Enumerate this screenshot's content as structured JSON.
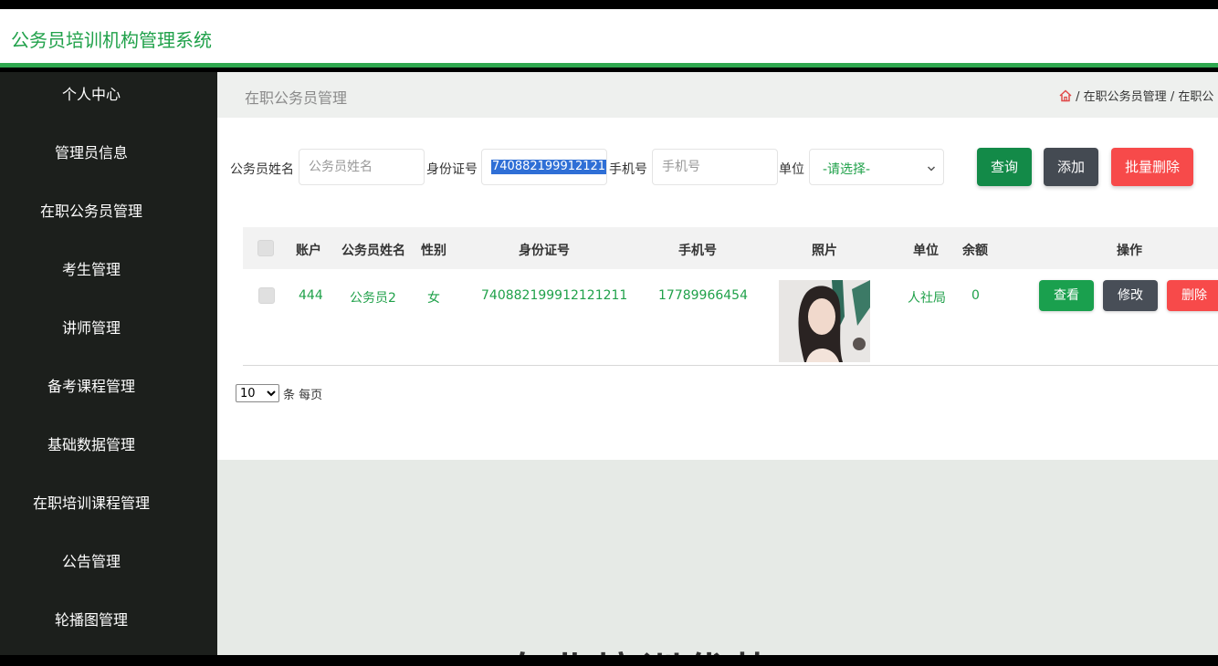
{
  "app": {
    "title": "公务员培训机构管理系统"
  },
  "sidebar": {
    "items": [
      {
        "label": "个人中心"
      },
      {
        "label": "管理员信息"
      },
      {
        "label": "在职公务员管理"
      },
      {
        "label": "考生管理"
      },
      {
        "label": "讲师管理"
      },
      {
        "label": "备考课程管理"
      },
      {
        "label": "基础数据管理"
      },
      {
        "label": "在职培训课程管理"
      },
      {
        "label": "公告管理"
      },
      {
        "label": "轮播图管理"
      }
    ]
  },
  "page": {
    "title": "在职公务员管理",
    "breadcrumb": {
      "sep": "/",
      "item1": "在职公务员管理",
      "item2": "在职公"
    }
  },
  "search": {
    "name_label": "公务员姓名",
    "name_placeholder": "公务员姓名",
    "id_label": "身份证号",
    "id_value": "740882199912121",
    "phone_label": "手机号",
    "phone_placeholder": "手机号",
    "unit_label": "单位",
    "unit_selected": "-请选择-",
    "query_button": "查询",
    "add_button": "添加",
    "bulk_delete_button": "批量删除"
  },
  "table": {
    "headers": {
      "account": "账户",
      "name": "公务员姓名",
      "gender": "性别",
      "id_number": "身份证号",
      "phone": "手机号",
      "photo": "照片",
      "unit": "单位",
      "balance": "余额",
      "actions": "操作"
    },
    "rows": [
      {
        "account": "444",
        "name": "公务员2",
        "gender": "女",
        "id_number": "740882199912121211",
        "phone": "17789966454",
        "unit": "人社局",
        "balance": "0",
        "view": "查看",
        "edit": "修改",
        "delete": "删除"
      }
    ]
  },
  "pager": {
    "page_size": "10",
    "suffix": "条 每页"
  },
  "background": {
    "banner_text": "专业培训优势"
  },
  "colors": {
    "brand_green": "#20a14a",
    "sidebar_bg": "#1c1f1c",
    "danger": "#f74a4a",
    "dark_button": "#444a52"
  }
}
